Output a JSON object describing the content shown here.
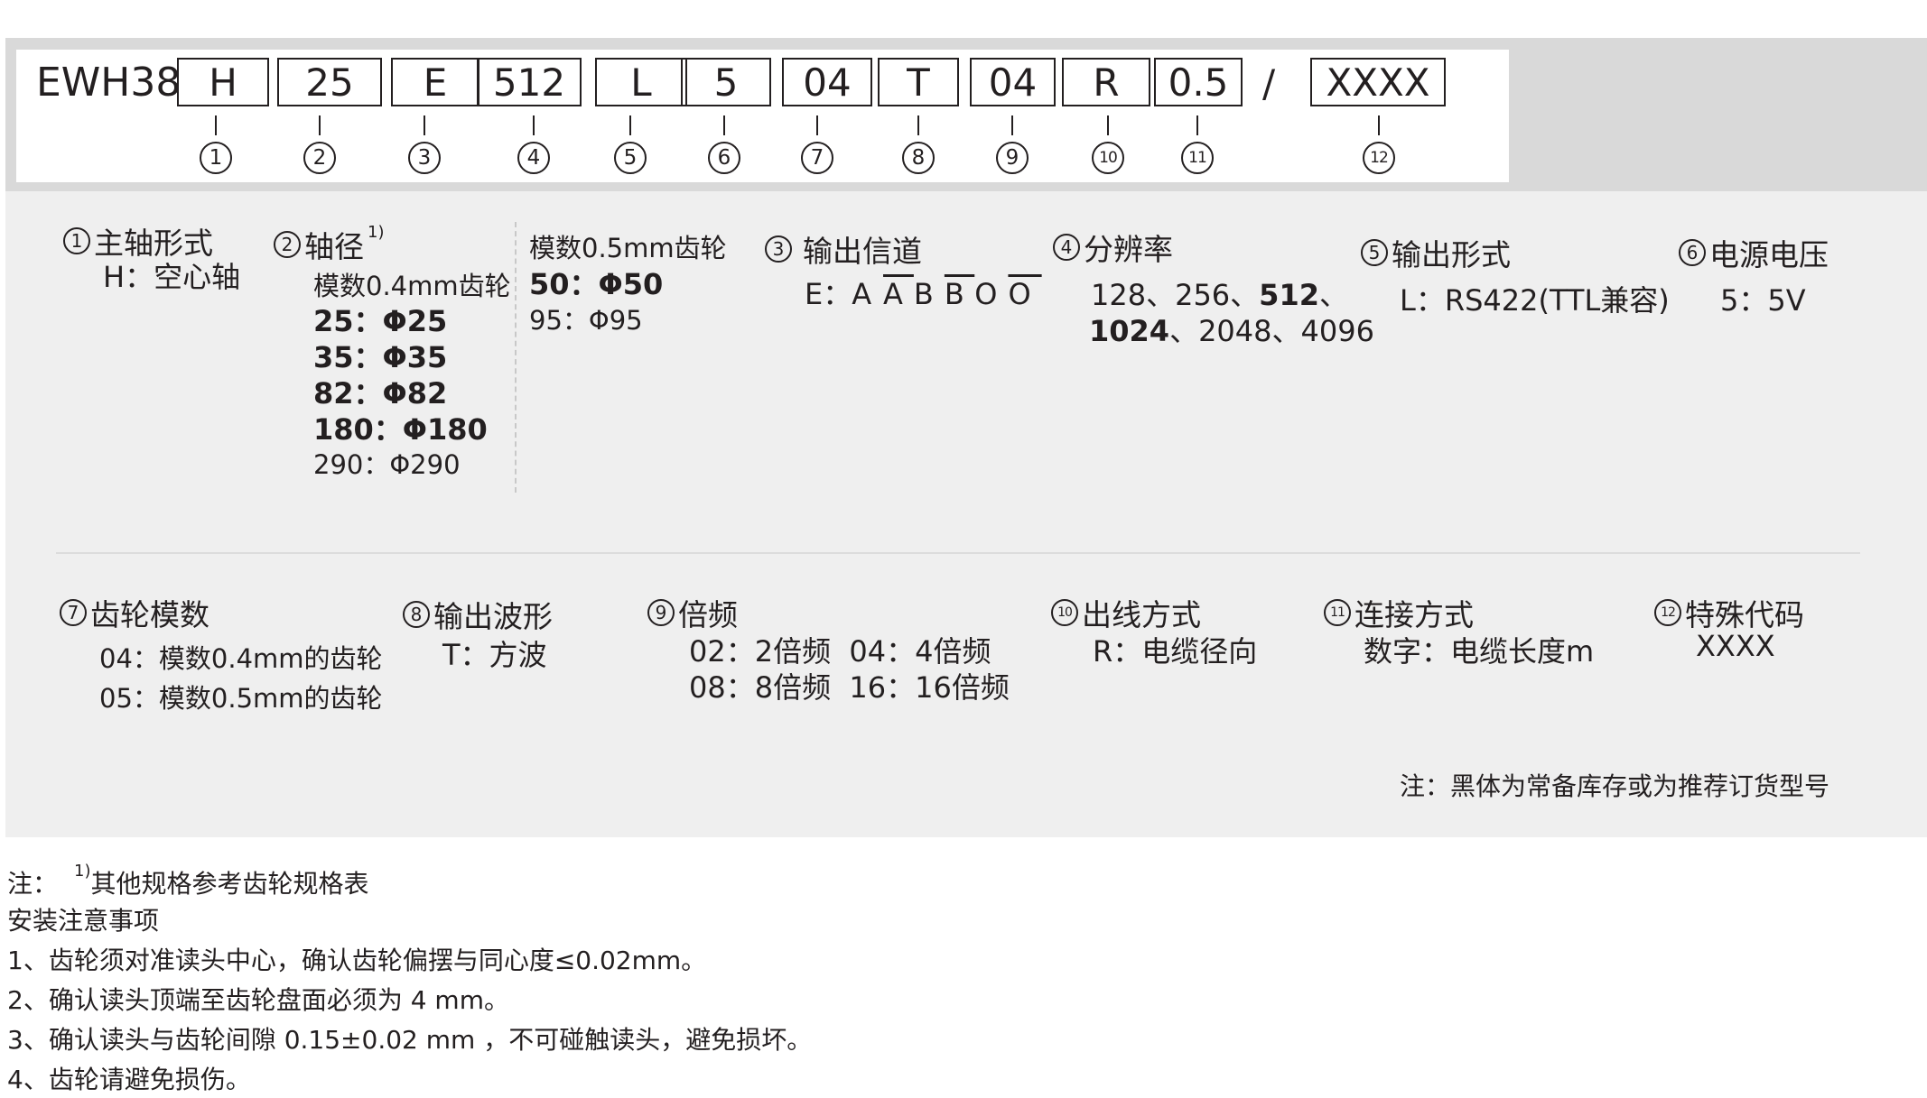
{
  "code": {
    "prefix": "EWH38",
    "boxes": [
      "H",
      "25",
      "E",
      "512",
      "L",
      "5",
      "04",
      "T",
      "04",
      "R",
      "0.5",
      "XXXX"
    ],
    "separator": "/",
    "numbers": [
      "1",
      "2",
      "3",
      "4",
      "5",
      "6",
      "7",
      "8",
      "9",
      "10",
      "11",
      "12"
    ]
  },
  "sections": {
    "s1": {
      "title": "主轴形式",
      "lines": [
        "H：空心轴"
      ]
    },
    "s2": {
      "title": "轴径",
      "sup": "1)",
      "sub_title": "模数0.4mm齿轮",
      "lines": [
        {
          "text": "25：Φ25",
          "bold": true
        },
        {
          "text": "35：Φ35",
          "bold": true
        },
        {
          "text": "82：Φ82",
          "bold": true
        },
        {
          "text": "180：Φ180",
          "bold": true
        },
        {
          "text": "290：Φ290",
          "bold": false
        }
      ]
    },
    "s2b": {
      "sub_title": "模数0.5mm齿轮",
      "lines": [
        {
          "text": "50：Φ50",
          "bold": true
        },
        {
          "text": "95：Φ95",
          "bold": false
        }
      ]
    },
    "s3": {
      "title": "输出信道",
      "prefix": "E：",
      "signals": [
        {
          "t": "A",
          "ov": false
        },
        {
          "t": "A",
          "ov": true
        },
        {
          "t": "B",
          "ov": false
        },
        {
          "t": "B",
          "ov": true
        },
        {
          "t": "O",
          "ov": false
        },
        {
          "t": "O",
          "ov": true
        }
      ]
    },
    "s4": {
      "title": "分辨率",
      "line1a": "128、256、",
      "line1b": "512",
      "line1c": "、",
      "line2a": "1024",
      "line2b": "、2048、4096"
    },
    "s5": {
      "title": "输出形式",
      "lines": [
        "L：RS422(TTL兼容)"
      ]
    },
    "s6": {
      "title": "电源电压",
      "lines": [
        "5：5V"
      ]
    },
    "s7": {
      "title": "齿轮模数",
      "lines": [
        "04：模数0.4mm的齿轮",
        "05：模数0.5mm的齿轮"
      ]
    },
    "s8": {
      "title": "输出波形",
      "lines": [
        "T：方波"
      ]
    },
    "s9": {
      "title": "倍频",
      "lines": [
        "02：2倍频  04：4倍频",
        "08：8倍频  16：16倍频"
      ]
    },
    "s10": {
      "title": "出线方式",
      "lines": [
        "R：电缆径向"
      ]
    },
    "s11": {
      "title": "连接方式",
      "lines": [
        "数字：电缆长度m"
      ]
    },
    "s12": {
      "title": "特殊代码",
      "lines": [
        "XXXX"
      ]
    }
  },
  "panel_note": "注：黑体为常备库存或为推荐订货型号",
  "footer": {
    "note_prefix": "注：",
    "note_sup": "1)",
    "note_text": "其他规格参考齿轮规格表",
    "heading": "安装注意事项",
    "items": [
      "1、齿轮须对准读头中心，确认齿轮偏摆与同心度≤0.02mm。",
      "2、确认读头顶端至齿轮盘面必须为 4 mm。",
      "3、确认读头与齿轮间隙 0.15±0.02 mm ，不可碰触读头，避免损坏。",
      "4、齿轮请避免损伤。"
    ]
  }
}
